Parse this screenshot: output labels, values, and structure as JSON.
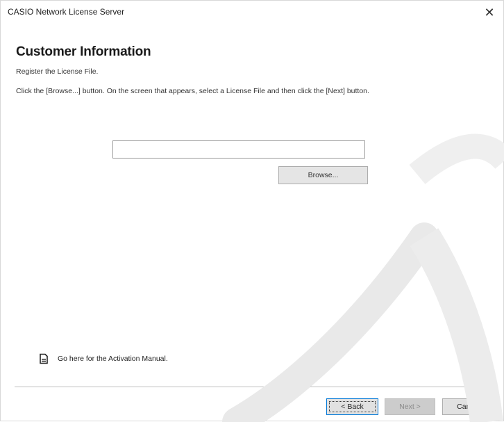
{
  "window": {
    "title": "CASIO Network License Server",
    "close_glyph": "✕"
  },
  "page": {
    "heading": "Customer Information",
    "subheading": "Register the License File.",
    "instruction": "Click the [Browse...] button. On the screen that appears, select a License File and then click the [Next] button."
  },
  "file_input": {
    "value": ""
  },
  "browse_button": {
    "label": "Browse..."
  },
  "manual_link": {
    "label": "Go here for the Activation Manual.",
    "icon": "document-icon"
  },
  "footer": {
    "back_label": "< Back",
    "next_label": "Next >",
    "cancel_label": "Cancel"
  },
  "colors": {
    "focus_border": "#0078d7",
    "disabled_text": "#8a8a8a",
    "watermark": "#e6e6e6"
  }
}
